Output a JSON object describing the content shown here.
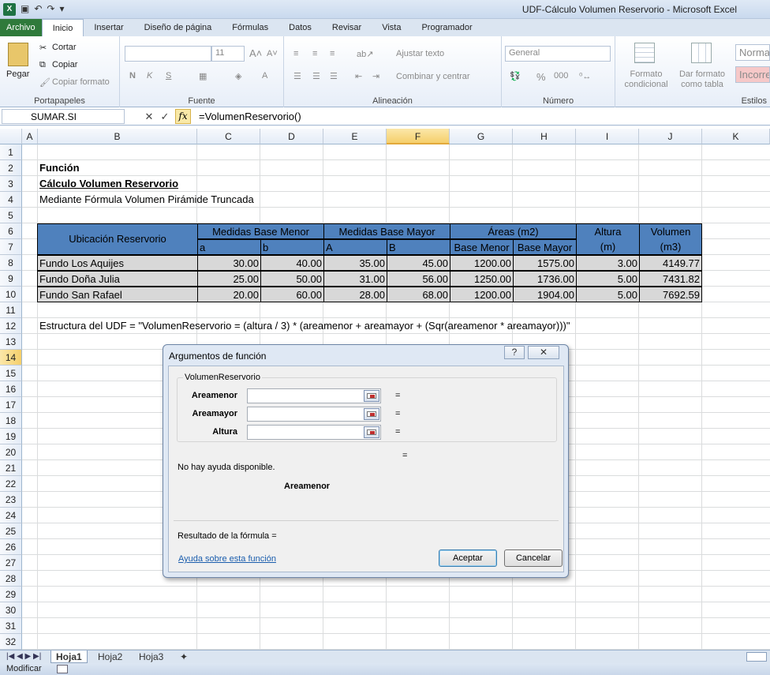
{
  "window": {
    "title": "UDF-Cálculo Volumen Reservorio  -  Microsoft Excel",
    "app_icon": "X"
  },
  "ribbon_tabs": [
    "Archivo",
    "Inicio",
    "Insertar",
    "Diseño de página",
    "Fórmulas",
    "Datos",
    "Revisar",
    "Vista",
    "Programador"
  ],
  "ribbon": {
    "portapapeles": {
      "pegar": "Pegar",
      "cortar": "Cortar",
      "copiar": "Copiar",
      "copiar_formato": "Copiar formato",
      "label": "Portapapeles"
    },
    "fuente": {
      "size": "11",
      "bold": "N",
      "italic": "K",
      "underline": "S",
      "label": "Fuente"
    },
    "alineacion": {
      "ajustar": "Ajustar texto",
      "combinar": "Combinar y centrar",
      "label": "Alineación"
    },
    "numero": {
      "format": "General",
      "percent": "%",
      "thousands": "000",
      "label": "Número"
    },
    "estilos": {
      "formato_condicional": "Formato condicional",
      "dar_formato": "Dar formato como tabla",
      "normal": "Normal",
      "incorrecto": "Incorrecto",
      "label": "Estilos"
    }
  },
  "formula_bar": {
    "name_box": "SUMAR.SI",
    "cancel": "✕",
    "enter": "✓",
    "fx": "fx",
    "formula": "=VolumenReservorio()"
  },
  "columns": [
    "A",
    "B",
    "C",
    "D",
    "E",
    "F",
    "G",
    "H",
    "I",
    "J",
    "K"
  ],
  "rows": [
    "1",
    "2",
    "3",
    "4",
    "5",
    "6",
    "7",
    "8",
    "9",
    "10",
    "11",
    "12",
    "13",
    "14",
    "15",
    "16",
    "17",
    "18",
    "19",
    "20",
    "21",
    "22",
    "23",
    "24",
    "25",
    "26",
    "27",
    "28",
    "29",
    "30",
    "31",
    "32"
  ],
  "cells": {
    "b2": "Función",
    "b3": "Cálculo Volumen Reservorio",
    "b4": "Mediante Fórmula Volumen Pirámide Truncada",
    "b12": "Estructura del UDF = \"VolumenReservorio = (altura / 3) * (areamenor + areamayor + (Sqr(areamenor * areamayor)))\""
  },
  "table": {
    "headers": {
      "ubicacion": "Ubicación Reservorio",
      "base_menor": "Medidas Base Menor",
      "base_mayor": "Medidas Base Mayor",
      "areas": "Áreas (m2)",
      "altura": "Altura",
      "altura_unit": "(m)",
      "volumen": "Volumen",
      "volumen_unit": "(m3)",
      "a": "a",
      "b": "b",
      "A": "A",
      "B": "B",
      "area_menor": "Base Menor",
      "area_mayor": "Base Mayor"
    },
    "rows": [
      {
        "ubicacion": "Fundo Los Aquijes",
        "a": "30.00",
        "b": "40.00",
        "A": "35.00",
        "B": "45.00",
        "area_menor": "1200.00",
        "area_mayor": "1575.00",
        "altura": "3.00",
        "volumen": "4149.77"
      },
      {
        "ubicacion": "Fundo Doña Julia",
        "a": "25.00",
        "b": "50.00",
        "A": "31.00",
        "B": "56.00",
        "area_menor": "1250.00",
        "area_mayor": "1736.00",
        "altura": "5.00",
        "volumen": "7431.82"
      },
      {
        "ubicacion": "Fundo San Rafael",
        "a": "20.00",
        "b": "60.00",
        "A": "28.00",
        "B": "68.00",
        "area_menor": "1200.00",
        "area_mayor": "1904.00",
        "altura": "5.00",
        "volumen": "7692.59"
      }
    ]
  },
  "dialog": {
    "title": "Argumentos de función",
    "help_button": "?",
    "close_button": "✕",
    "function_name": "VolumenReservorio",
    "args": [
      {
        "label": "Areamenor",
        "value": "",
        "eq": "="
      },
      {
        "label": "Areamayor",
        "value": "",
        "eq": "="
      },
      {
        "label": "Altura",
        "value": "",
        "eq": "="
      }
    ],
    "result_eq": "=",
    "no_help": "No hay ayuda disponible.",
    "current_arg": "Areamenor",
    "result_label": "Resultado de la fórmula =",
    "help_link": "Ayuda sobre esta función",
    "ok": "Aceptar",
    "cancel": "Cancelar"
  },
  "sheets": [
    "Hoja1",
    "Hoja2",
    "Hoja3"
  ],
  "status": {
    "mode": "Modificar"
  }
}
